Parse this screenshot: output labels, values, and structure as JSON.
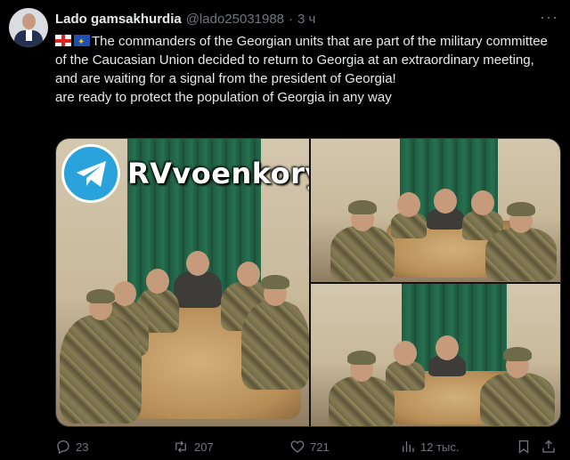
{
  "post": {
    "author_name": "Lado gamsakhurdia",
    "handle": "@lado25031988",
    "separator": "·",
    "time": "3 ч",
    "text_line_1": "The commanders of the Georgian units that are part of the military committee of the Caucasian Union decided to return to Georgia at an extraordinary meeting, and are waiting for a signal from the president of Georgia!",
    "text_line_2": "are ready to protect the population of Georgia in any way"
  },
  "media": {
    "watermark": "RVvoenkory"
  },
  "actions": {
    "replies": "23",
    "reposts": "207",
    "likes": "721",
    "views": "12 тыс."
  },
  "colors": {
    "background": "#000000",
    "text": "#e7e9ea",
    "muted": "#71767b",
    "telegram_blue": "#2aa3dd"
  },
  "icons": [
    "more-icon",
    "georgia-flag-icon",
    "eu-flag-icon",
    "telegram-icon",
    "reply-icon",
    "repost-icon",
    "like-icon",
    "views-icon",
    "bookmark-icon",
    "share-icon"
  ]
}
